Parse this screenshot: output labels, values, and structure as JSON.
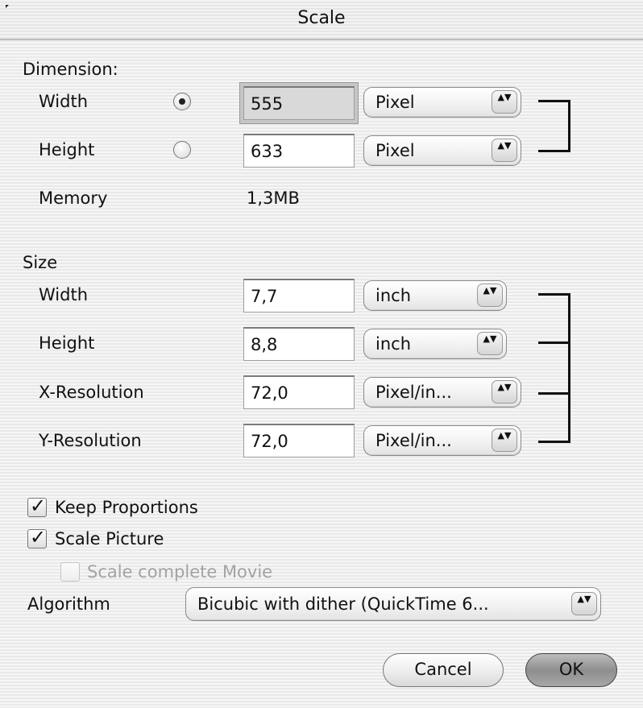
{
  "window": {
    "title": "Scale"
  },
  "dimension": {
    "section_label": "Dimension:",
    "width_label": "Width",
    "width_value": "555",
    "width_unit": "Pixel",
    "height_label": "Height",
    "height_value": "633",
    "height_unit": "Pixel",
    "memory_label": "Memory",
    "memory_value": "1,3MB",
    "selected_radio": "width"
  },
  "size": {
    "section_label": "Size",
    "width_label": "Width",
    "width_value": "7,7",
    "width_unit": "inch",
    "height_label": "Height",
    "height_value": "8,8",
    "height_unit": "inch",
    "xres_label": "X-Resolution",
    "xres_value": "72,0",
    "xres_unit": "Pixel/in...",
    "yres_label": "Y-Resolution",
    "yres_value": "72,0",
    "yres_unit": "Pixel/in..."
  },
  "options": {
    "keep_proportions_label": "Keep Proportions",
    "keep_proportions_checked": true,
    "scale_picture_label": "Scale Picture",
    "scale_picture_checked": true,
    "scale_movie_label": "Scale complete Movie",
    "scale_movie_checked": false,
    "scale_movie_enabled": false
  },
  "algorithm": {
    "label": "Algorithm",
    "value": "Bicubic with dither (QuickTime 6..."
  },
  "buttons": {
    "cancel": "Cancel",
    "ok": "OK"
  },
  "popup_arrow_glyph": "▲▼",
  "check_glyph": "✓"
}
